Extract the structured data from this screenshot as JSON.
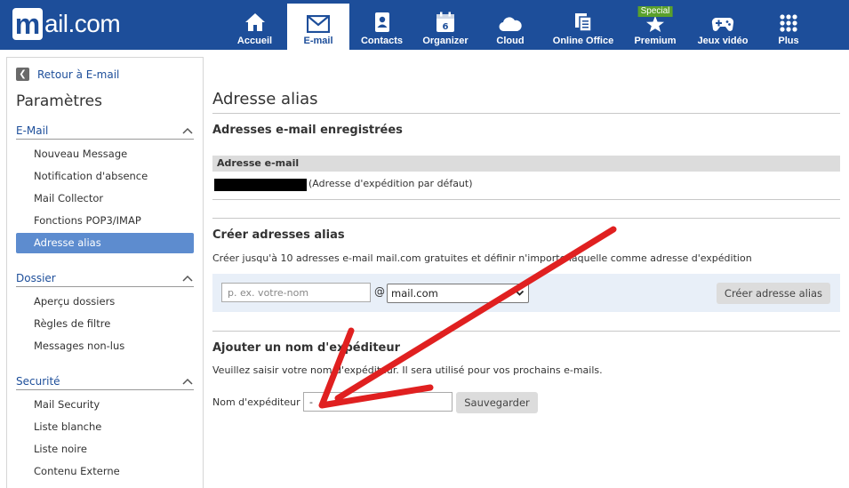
{
  "brand": {
    "logo_m": "m",
    "logo_text": "ail.com"
  },
  "nav": [
    {
      "label": "Accueil",
      "icon": "home-icon"
    },
    {
      "label": "E-mail",
      "icon": "envelope-icon"
    },
    {
      "label": "Contacts",
      "icon": "contacts-icon"
    },
    {
      "label": "Organizer",
      "icon": "calendar-icon",
      "day": "6"
    },
    {
      "label": "Cloud",
      "icon": "cloud-icon"
    },
    {
      "label": "Online Office",
      "icon": "office-icon"
    },
    {
      "label": "Premium",
      "icon": "star-icon",
      "badge": "Special"
    },
    {
      "label": "Jeux vidéo",
      "icon": "gamepad-icon"
    },
    {
      "label": "Plus",
      "icon": "grid-icon"
    }
  ],
  "sidebar": {
    "back_label": "Retour à E-mail",
    "title": "Paramètres",
    "sections": [
      {
        "title": "E-Mail",
        "items": [
          "Nouveau Message",
          "Notification d'absence",
          "Mail Collector",
          "Fonctions POP3/IMAP",
          "Adresse alias"
        ]
      },
      {
        "title": "Dossier",
        "items": [
          "Aperçu dossiers",
          "Règles de filtre",
          "Messages non-lus"
        ]
      },
      {
        "title": "Securité",
        "items": [
          "Mail Security",
          "Liste blanche",
          "Liste noire",
          "Contenu Externe"
        ]
      }
    ]
  },
  "main": {
    "title": "Adresse alias",
    "registered": {
      "heading": "Adresses e-mail enregistrées",
      "column": "Adresse e-mail",
      "note": "(Adresse d'expédition par défaut)"
    },
    "create": {
      "heading": "Créer adresses alias",
      "description": "Créer jusqu'à 10 adresses e-mail mail.com gratuites et définir n'importe laquelle comme adresse d'expédition",
      "placeholder": "p. ex. votre-nom",
      "at": "@",
      "domain": "mail.com",
      "button": "Créer adresse alias"
    },
    "sender": {
      "heading": "Ajouter un nom d'expéditeur",
      "description": "Veuillez saisir votre nom d'expéditeur. Il sera utilisé pour vos prochains e-mails.",
      "label": "Nom d'expéditeur",
      "value": "-",
      "button": "Sauvegarder"
    }
  },
  "colors": {
    "brand": "#1d4e9a",
    "active": "#5d8ccf",
    "annotation": "#e02020",
    "special": "#5aa02c"
  }
}
